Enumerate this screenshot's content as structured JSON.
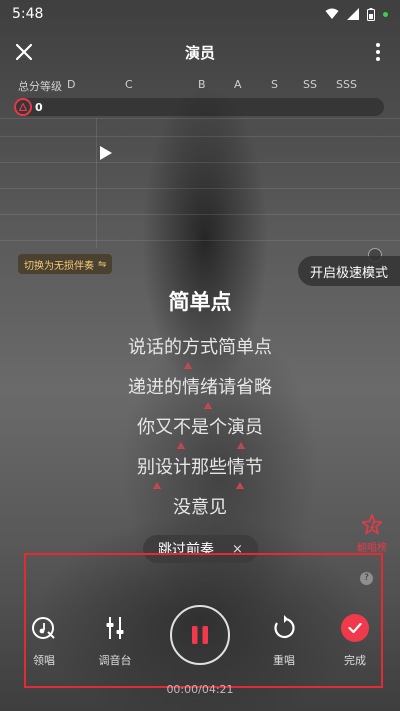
{
  "status_bar": {
    "time": "5:48"
  },
  "header": {
    "title": "演员"
  },
  "grades": {
    "label": "总分等级",
    "levels": [
      "D",
      "C",
      "B",
      "A",
      "S",
      "SS",
      "SSS"
    ],
    "score": "0"
  },
  "chips": {
    "switch_accompaniment": "切换为无损伴奏",
    "switch_icon": "⇋",
    "fast_mode": "开启极速模式",
    "skip_intro": "跳过前奏",
    "skip_close": "×"
  },
  "lyrics": {
    "current": "简单点",
    "lines": [
      "说话的方式简单点",
      "递进的情绪请省略",
      "你又不是个演员",
      "别设计那些情节",
      "没意见"
    ]
  },
  "floating": {
    "label": "翻唱榜"
  },
  "controls": {
    "help": "?",
    "lead_vocal": "领唱",
    "mixer": "调音台",
    "restart": "重唱",
    "finish": "完成"
  },
  "playback": {
    "time": "00:00/04:21"
  },
  "colors": {
    "accent": "#f0394a",
    "gold": "#f3c977",
    "panel_border": "#e32b36"
  }
}
